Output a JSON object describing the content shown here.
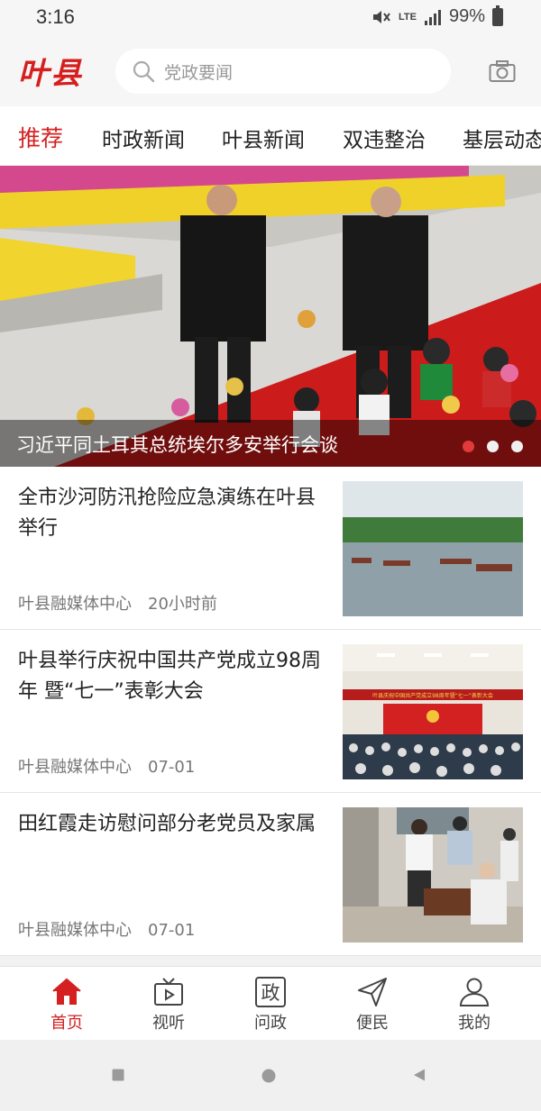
{
  "status": {
    "time": "3:16",
    "network": "LTE",
    "battery": "99%"
  },
  "header": {
    "logo": "叶县",
    "search_placeholder": "党政要闻"
  },
  "tabs": [
    {
      "label": "推荐",
      "active": true
    },
    {
      "label": "时政新闻"
    },
    {
      "label": "叶县新闻"
    },
    {
      "label": "双违整治"
    },
    {
      "label": "基层动态"
    }
  ],
  "banner": {
    "caption": "习近平同土耳其总统埃尔多安举行会谈",
    "dots": 3,
    "active_dot": 0
  },
  "news": [
    {
      "title": "全市沙河防汛抢险应急演练在叶县举行",
      "source": "叶县融媒体中心",
      "time": "20小时前"
    },
    {
      "title": "叶县举行庆祝中国共产党成立98周年 暨“七一”表彰大会",
      "source": "叶县融媒体中心",
      "time": "07-01",
      "thumb_banner": "叶县庆祝中国共产党成立98周年暨“七一”表彰大会"
    },
    {
      "title": "田红霞走访慰问部分老党员及家属",
      "source": "叶县融媒体中心",
      "time": "07-01"
    }
  ],
  "bottom_nav": [
    {
      "label": "首页",
      "icon": "home-icon",
      "active": true
    },
    {
      "label": "视听",
      "icon": "tv-icon"
    },
    {
      "label": "问政",
      "icon": "zheng-icon",
      "glyph": "政"
    },
    {
      "label": "便民",
      "icon": "send-icon"
    },
    {
      "label": "我的",
      "icon": "user-icon"
    }
  ],
  "colors": {
    "accent": "#d42020",
    "text": "#222222",
    "meta": "#777777"
  }
}
